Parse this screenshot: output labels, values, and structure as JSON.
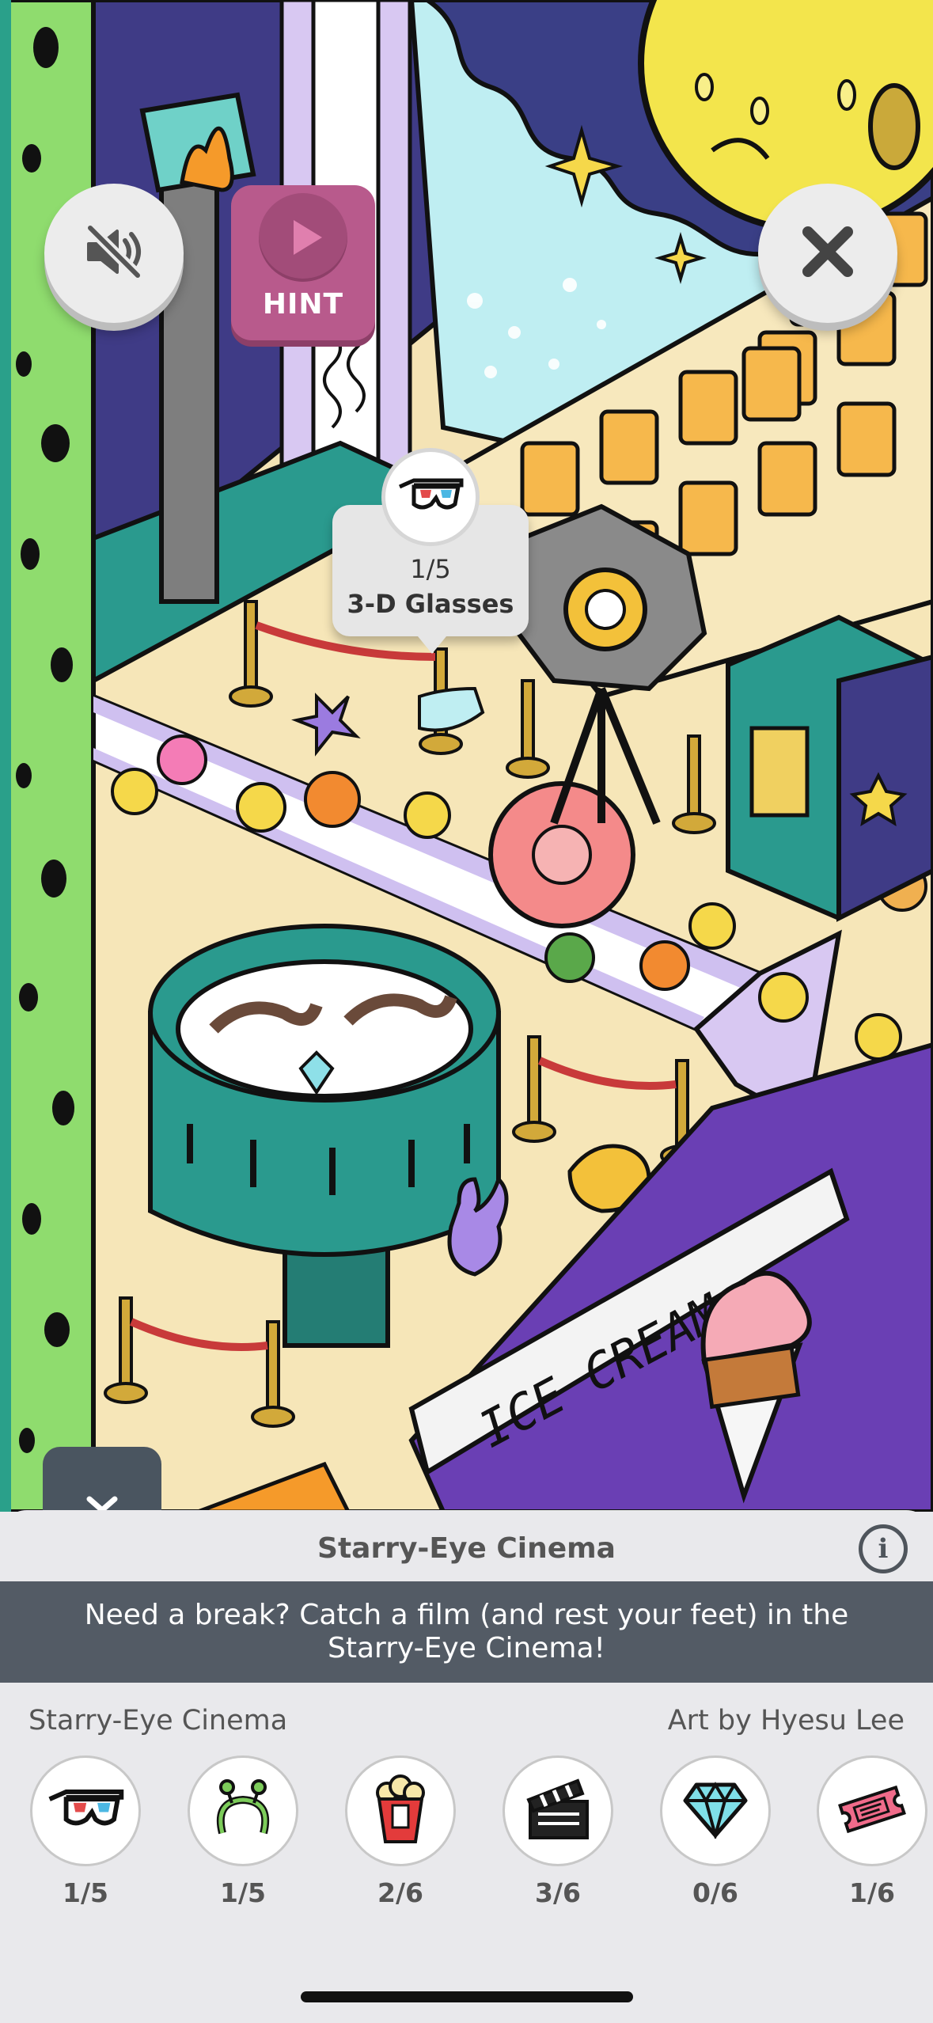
{
  "scene": {
    "ice_cream_sign": "ICE CREAM"
  },
  "controls": {
    "mute_icon": "speaker-muted-icon",
    "hint_label": "HINT",
    "close_icon": "close-icon",
    "collapse_icon": "chevron-down-icon"
  },
  "tooltip": {
    "icon": "3d-glasses-icon",
    "count": "1/5",
    "name": "3-D Glasses"
  },
  "panel": {
    "title": "Starry-Eye Cinema",
    "description": "Need a break? Catch a film (and rest your feet) in the Starry-Eye Cinema!",
    "scene_name": "Starry-Eye Cinema",
    "artist": "Art by Hyesu Lee",
    "items": [
      {
        "icon": "3d-glasses-icon",
        "count": "1/5"
      },
      {
        "icon": "alien-headband-icon",
        "count": "1/5"
      },
      {
        "icon": "popcorn-icon",
        "count": "2/6"
      },
      {
        "icon": "clapperboard-icon",
        "count": "3/6"
      },
      {
        "icon": "diamond-icon",
        "count": "0/6"
      },
      {
        "icon": "ticket-icon",
        "count": "1/6"
      }
    ]
  },
  "colors": {
    "accent_hint": "#b85a8c",
    "panel_dark": "#535b65",
    "teal": "#2a9a8e",
    "cream": "#f6e6b8",
    "purple": "#3e3a86"
  }
}
